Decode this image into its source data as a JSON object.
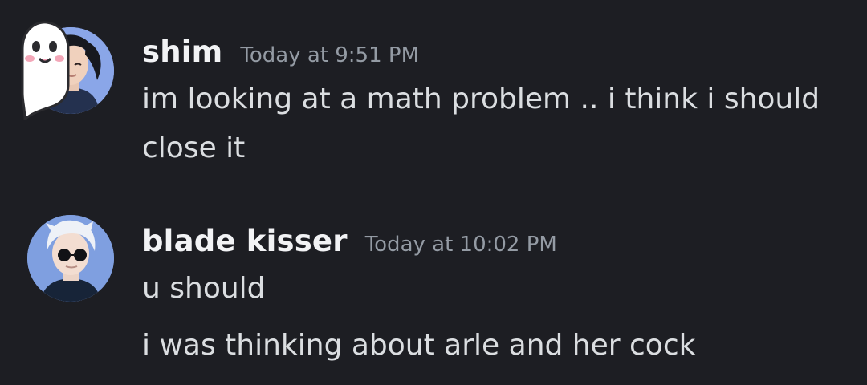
{
  "messages": [
    {
      "username": "shim",
      "timestamp": "Today at 9:51 PM",
      "lines": [
        "im looking at a math problem .. i think i should",
        "close it"
      ],
      "avatar_icon": "anime-character-avatar",
      "decoration_icon": "ghost-decoration-icon"
    },
    {
      "username": "blade kisser",
      "timestamp": "Today at 10:02 PM",
      "lines": [
        "u should",
        "i was thinking about arle and her cock"
      ],
      "avatar_icon": "anime-character-avatar"
    }
  ],
  "colors": {
    "background": "#1d1e23",
    "username": "#f2f3f5",
    "timestamp": "#949ba4",
    "message_text": "#dbdee1"
  }
}
